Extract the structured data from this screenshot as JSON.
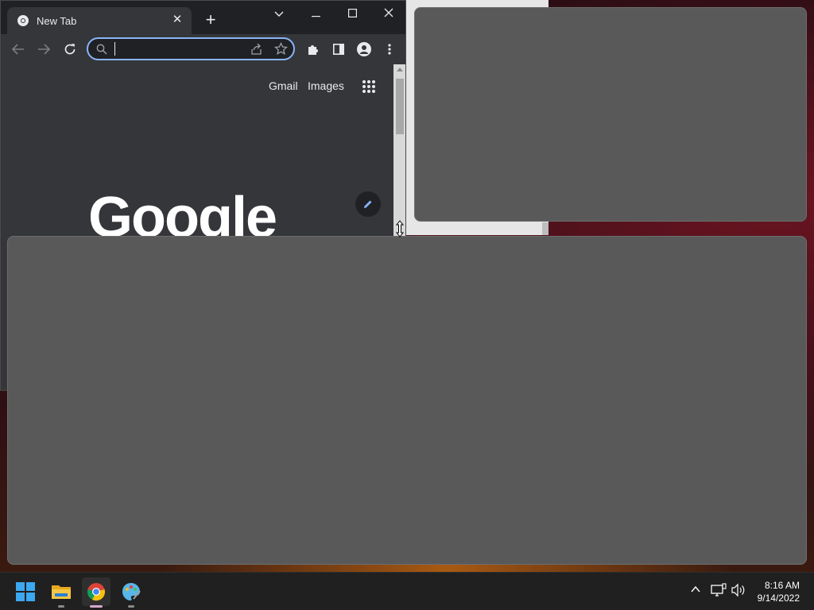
{
  "browser": {
    "tab_title": "New Tab",
    "tab_close_label": "✕",
    "new_tab_label": "+",
    "omnibox_value": "",
    "links": {
      "gmail": "Gmail",
      "images": "Images"
    },
    "logo_text": "Google",
    "accent_color": "#8ab4f8"
  },
  "taskbar": {
    "apps": [
      "start",
      "file-explorer",
      "chrome",
      "paint"
    ],
    "active_app": "chrome",
    "time": "8:16 AM",
    "date": "9/14/2022"
  },
  "icons": {
    "tab_favicon": "chrome-icon",
    "back": "back-arrow-icon",
    "forward": "forward-arrow-icon",
    "reload": "reload-icon",
    "share": "share-icon",
    "bookmark": "star-icon",
    "extensions": "puzzle-icon",
    "side_panel": "side-panel-icon",
    "profile": "profile-icon",
    "menu": "more-vert-icon",
    "apps": "apps-grid-icon",
    "customize": "pencil-icon"
  }
}
